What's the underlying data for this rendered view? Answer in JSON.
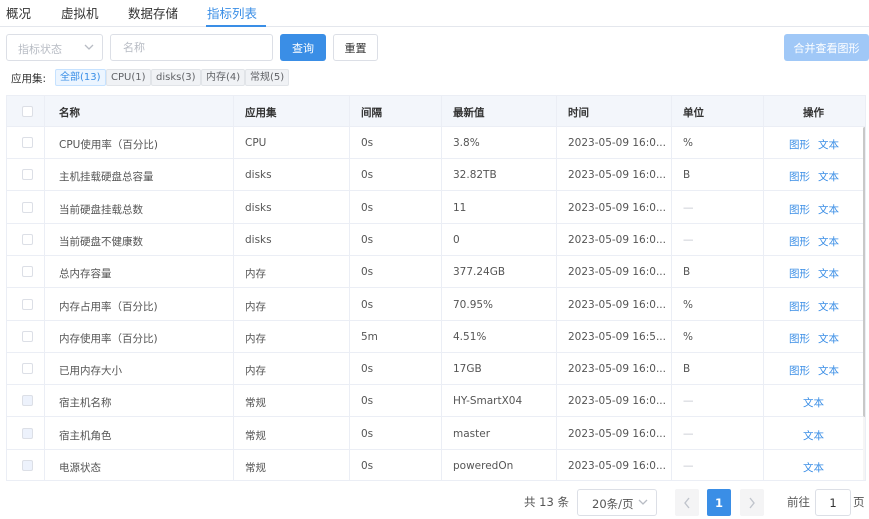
{
  "tabs": [
    "概况",
    "虚拟机",
    "数据存储",
    "指标列表"
  ],
  "active_tab": 3,
  "filter": {
    "status_placeholder": "指标状态",
    "name_placeholder": "名称",
    "query_label": "查询",
    "reset_label": "重置",
    "merge_label": "合并查看图形"
  },
  "appset": {
    "label": "应用集:",
    "chips": [
      "全部(13)",
      "CPU(1)",
      "disks(3)",
      "内存(4)",
      "常规(5)"
    ],
    "active": 0
  },
  "table": {
    "headers": [
      "名称",
      "应用集",
      "间隔",
      "最新值",
      "时间",
      "单位",
      "操作"
    ],
    "ops": {
      "graph": "图形",
      "text": "文本"
    },
    "rows": [
      {
        "name": "CPU使用率（百分比)",
        "app": "CPU",
        "interval": "0s",
        "value": "3.8%",
        "time": "2023-05-09 16:0...",
        "unit": "%",
        "graph": true
      },
      {
        "name": "主机挂载硬盘总容量",
        "app": "disks",
        "interval": "0s",
        "value": "32.82TB",
        "time": "2023-05-09 16:0...",
        "unit": "B",
        "graph": true
      },
      {
        "name": "当前硬盘挂载总数",
        "app": "disks",
        "interval": "0s",
        "value": "11",
        "time": "2023-05-09 16:0...",
        "unit": "—",
        "graph": true
      },
      {
        "name": "当前硬盘不健康数",
        "app": "disks",
        "interval": "0s",
        "value": "0",
        "time": "2023-05-09 16:0...",
        "unit": "—",
        "graph": true
      },
      {
        "name": "总内存容量",
        "app": "内存",
        "interval": "0s",
        "value": "377.24GB",
        "time": "2023-05-09 16:0...",
        "unit": "B",
        "graph": true
      },
      {
        "name": "内存占用率（百分比)",
        "app": "内存",
        "interval": "0s",
        "value": "70.95%",
        "time": "2023-05-09 16:0...",
        "unit": "%",
        "graph": true
      },
      {
        "name": "内存使用率（百分比)",
        "app": "内存",
        "interval": "5m",
        "value": "4.51%",
        "time": "2023-05-09 16:5...",
        "unit": "%",
        "graph": true
      },
      {
        "name": "已用内存大小",
        "app": "内存",
        "interval": "0s",
        "value": "17GB",
        "time": "2023-05-09 16:0...",
        "unit": "B",
        "graph": true
      },
      {
        "name": "宿主机名称",
        "app": "常规",
        "interval": "0s",
        "value": "HY-SmartX04",
        "time": "2023-05-09 16:0...",
        "unit": "—",
        "graph": false
      },
      {
        "name": "宿主机角色",
        "app": "常规",
        "interval": "0s",
        "value": "master",
        "time": "2023-05-09 16:0...",
        "unit": "—",
        "graph": false
      },
      {
        "name": "电源状态",
        "app": "常规",
        "interval": "0s",
        "value": "poweredOn",
        "time": "2023-05-09 16:0...",
        "unit": "—",
        "graph": false
      }
    ]
  },
  "pagination": {
    "total": "共 13 条",
    "page_size": "20条/页",
    "current_page": "1",
    "goto_label": "前往",
    "goto_value": "1",
    "page_suffix": "页"
  }
}
